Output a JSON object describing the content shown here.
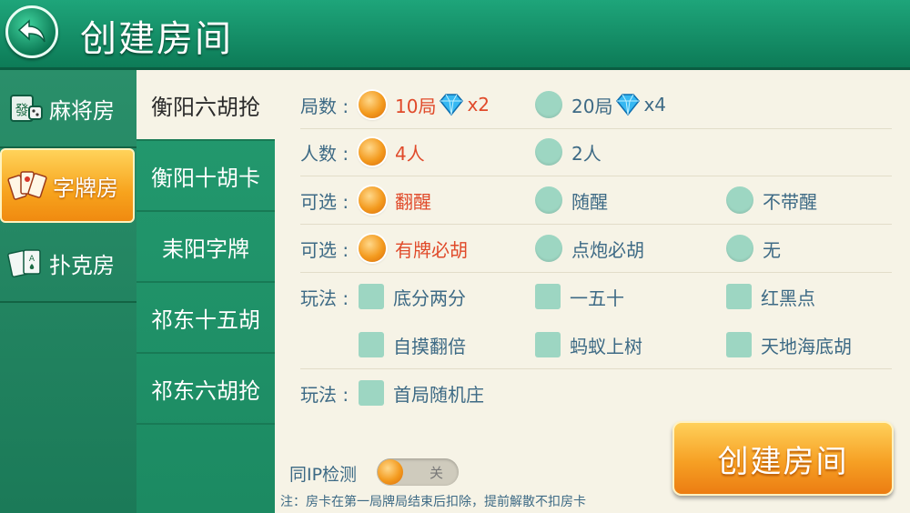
{
  "header": {
    "title": "创建房间"
  },
  "sidebar": {
    "items": [
      {
        "label": "麻将房",
        "icon": "mahjong-tile-icon"
      },
      {
        "label": "字牌房",
        "icon": "word-cards-icon",
        "active": true
      },
      {
        "label": "扑克房",
        "icon": "poker-cards-icon"
      }
    ]
  },
  "games": [
    "衡阳六胡抢",
    "衡阳十胡卡",
    "耒阳字牌",
    "祁东十五胡",
    "祁东六胡抢"
  ],
  "options": {
    "rounds": {
      "label": "局数 :",
      "a": "10局",
      "a_mult": "x2",
      "b": "20局",
      "b_mult": "x4"
    },
    "players": {
      "label": "人数 :",
      "a": "4人",
      "b": "2人"
    },
    "wake": {
      "label": "可选 :",
      "a": "翻醒",
      "b": "随醒",
      "c": "不带醒"
    },
    "hu": {
      "label": "可选 :",
      "a": "有牌必胡",
      "b": "点炮必胡",
      "c": "无"
    },
    "play1": {
      "label": "玩法 :",
      "a": "底分两分",
      "b": "一五十",
      "c": "红黑点",
      "d": "自摸翻倍",
      "e": "蚂蚁上树",
      "f": "天地海底胡"
    },
    "play2": {
      "label": "玩法 :",
      "a": "首局随机庄"
    }
  },
  "ip": {
    "label": "同IP检测",
    "toggle": "关"
  },
  "note": "注：房卡在第一局牌局结束后扣除，提前解散不扣房卡",
  "create_button": "创建房间",
  "colors": {
    "accent": "#f6a024",
    "selected_text": "#e04a2a",
    "label_text": "#3d6a85",
    "panel_bg": "#f6f3e6"
  }
}
